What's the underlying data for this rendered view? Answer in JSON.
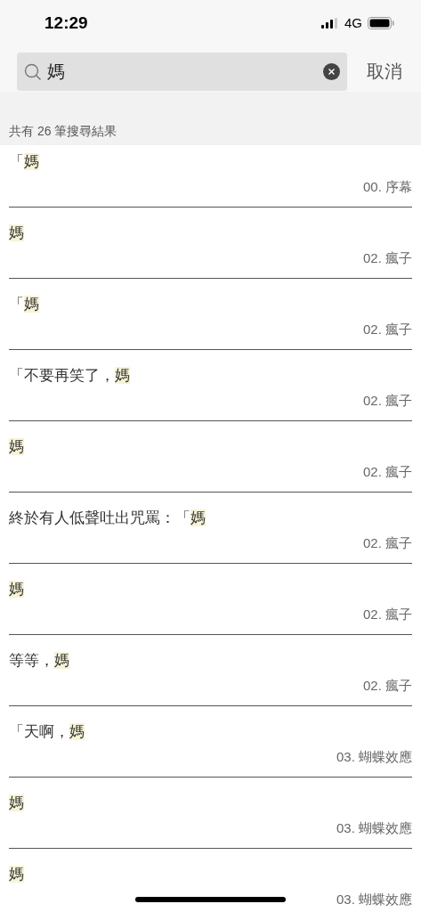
{
  "status_bar": {
    "time": "12:29",
    "network": "4G"
  },
  "search": {
    "value": "媽",
    "cancel": "取消"
  },
  "result_count": "共有 26 筆搜尋結果",
  "results": [
    {
      "before": "「",
      "match": "媽",
      "chapter": "00. 序幕"
    },
    {
      "match": "媽",
      "chapter": "02. 瘋子"
    },
    {
      "before": "「",
      "match": "媽",
      "chapter": "02. 瘋子"
    },
    {
      "before": "「不要再笑了，",
      "match": "媽",
      "chapter": "02. 瘋子"
    },
    {
      "match": "媽",
      "chapter": "02. 瘋子"
    },
    {
      "before": "終於有人低聲吐出咒罵：「",
      "match": "媽",
      "chapter": "02. 瘋子"
    },
    {
      "match": "媽",
      "chapter": "02. 瘋子"
    },
    {
      "before": "等等，",
      "match": "媽",
      "chapter": "02. 瘋子"
    },
    {
      "before": "「天啊，",
      "match": "媽",
      "chapter": "03. 蝴蝶效應"
    },
    {
      "match": "媽",
      "chapter": "03. 蝴蝶效應"
    },
    {
      "match": "媽",
      "chapter": "03. 蝴蝶效應"
    }
  ]
}
